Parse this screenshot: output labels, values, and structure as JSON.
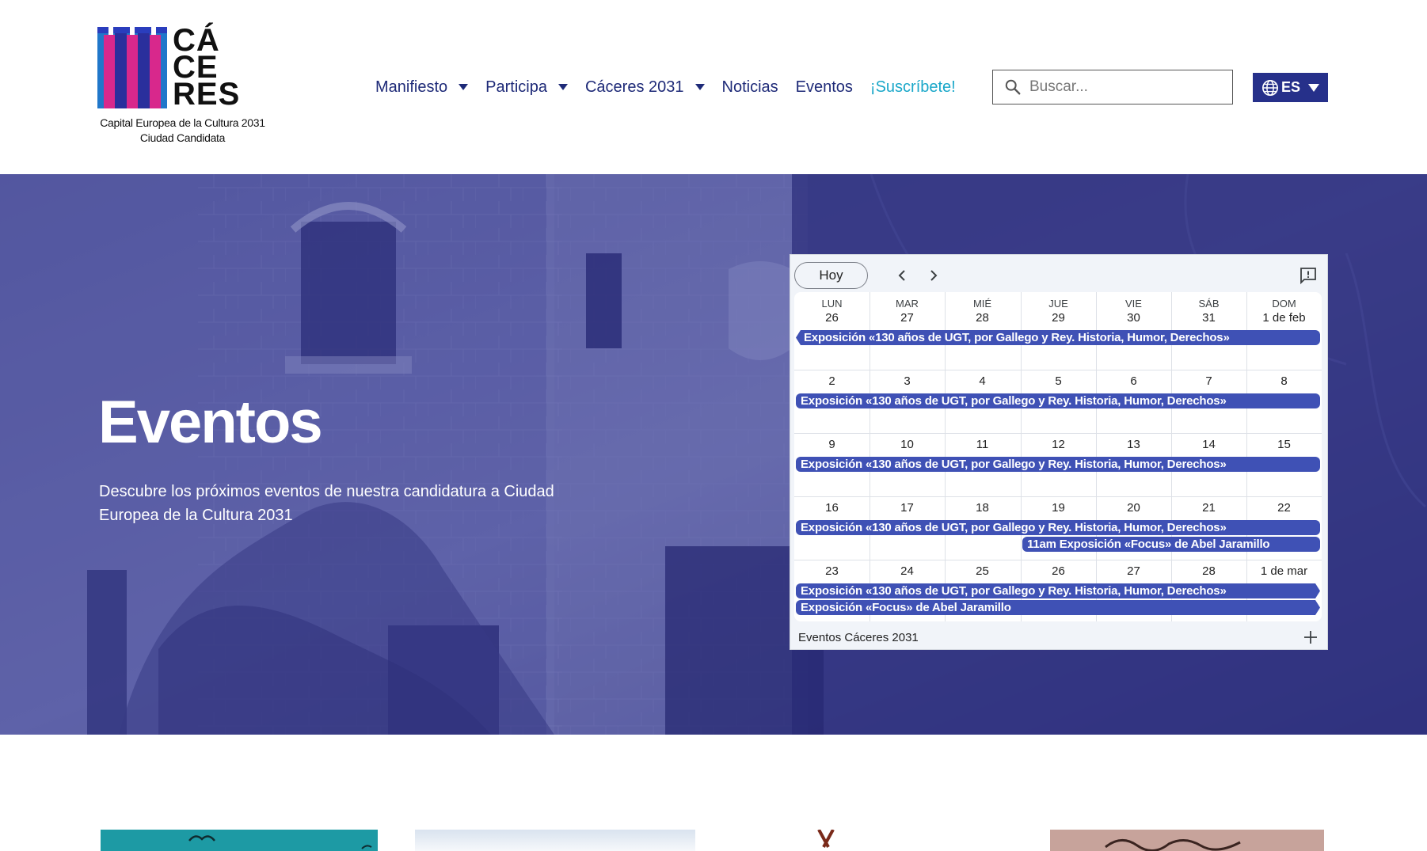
{
  "header": {
    "logo": {
      "word_lines": [
        "CÁ",
        "CE",
        "RES"
      ],
      "caption_line1": "Capital Europea de la Cultura 2031",
      "caption_line2": "Ciudad Candidata"
    },
    "nav": [
      {
        "label": "Manifiesto",
        "has_dropdown": true
      },
      {
        "label": "Participa",
        "has_dropdown": true
      },
      {
        "label": "Cáceres 2031",
        "has_dropdown": true
      },
      {
        "label": "Noticias",
        "has_dropdown": false
      },
      {
        "label": "Eventos",
        "has_dropdown": false
      },
      {
        "label": "¡Suscríbete!",
        "has_dropdown": false
      }
    ],
    "search": {
      "placeholder": "Buscar...",
      "icon": "search-icon"
    },
    "language": {
      "label": "ES",
      "icon": "globe-icon"
    }
  },
  "hero": {
    "title": "Eventos",
    "subtitle": "Descubre los próximos eventos de nuestra candidatura a Ciudad Europea de la Cultura 2031"
  },
  "calendar": {
    "today_label": "Hoy",
    "weekdays": [
      "LUN",
      "MAR",
      "MIÉ",
      "JUE",
      "VIE",
      "SÁB",
      "DOM"
    ],
    "first_week_dates": [
      "26",
      "27",
      "28",
      "29",
      "30",
      "31",
      "1 de feb"
    ],
    "weeks": [
      [
        "2",
        "3",
        "4",
        "5",
        "6",
        "7",
        "8"
      ],
      [
        "9",
        "10",
        "11",
        "12",
        "13",
        "14",
        "15"
      ],
      [
        "16",
        "17",
        "18",
        "19",
        "20",
        "21",
        "22"
      ],
      [
        "23",
        "24",
        "25",
        "26",
        "27",
        "28",
        "1 de mar"
      ]
    ],
    "events": {
      "ugt": "Exposición «130 años de UGT, por Gallego y Rey. Historia, Humor, Derechos»",
      "focus_timed": "11am Exposición «Focus» de Abel Jaramillo",
      "focus": "Exposición «Focus» de Abel Jaramillo"
    },
    "footer_label": "Eventos Cáceres 2031",
    "event_color": "#3f51b5"
  },
  "colors": {
    "nav_text": "#1e2a78",
    "accent": "#19a7c9",
    "hero_tint": "#3a3d8c",
    "lang_bg": "#26308a"
  }
}
